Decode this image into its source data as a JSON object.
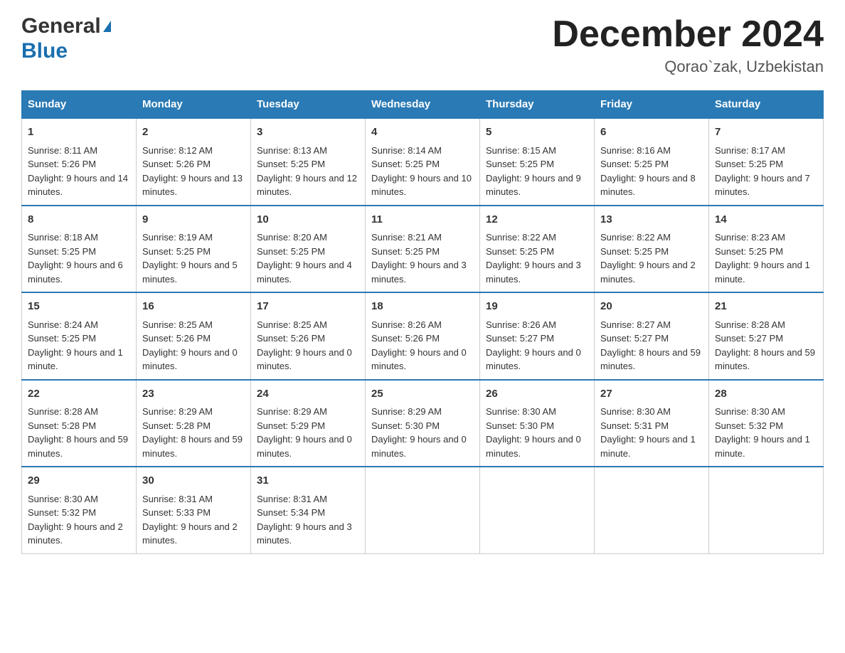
{
  "logo": {
    "line1": "General",
    "triangle": "▶",
    "line2": "Blue"
  },
  "title": "December 2024",
  "subtitle": "Qorao`zak, Uzbekistan",
  "days_of_week": [
    "Sunday",
    "Monday",
    "Tuesday",
    "Wednesday",
    "Thursday",
    "Friday",
    "Saturday"
  ],
  "weeks": [
    [
      {
        "day": "1",
        "sunrise": "Sunrise: 8:11 AM",
        "sunset": "Sunset: 5:26 PM",
        "daylight": "Daylight: 9 hours and 14 minutes."
      },
      {
        "day": "2",
        "sunrise": "Sunrise: 8:12 AM",
        "sunset": "Sunset: 5:26 PM",
        "daylight": "Daylight: 9 hours and 13 minutes."
      },
      {
        "day": "3",
        "sunrise": "Sunrise: 8:13 AM",
        "sunset": "Sunset: 5:25 PM",
        "daylight": "Daylight: 9 hours and 12 minutes."
      },
      {
        "day": "4",
        "sunrise": "Sunrise: 8:14 AM",
        "sunset": "Sunset: 5:25 PM",
        "daylight": "Daylight: 9 hours and 10 minutes."
      },
      {
        "day": "5",
        "sunrise": "Sunrise: 8:15 AM",
        "sunset": "Sunset: 5:25 PM",
        "daylight": "Daylight: 9 hours and 9 minutes."
      },
      {
        "day": "6",
        "sunrise": "Sunrise: 8:16 AM",
        "sunset": "Sunset: 5:25 PM",
        "daylight": "Daylight: 9 hours and 8 minutes."
      },
      {
        "day": "7",
        "sunrise": "Sunrise: 8:17 AM",
        "sunset": "Sunset: 5:25 PM",
        "daylight": "Daylight: 9 hours and 7 minutes."
      }
    ],
    [
      {
        "day": "8",
        "sunrise": "Sunrise: 8:18 AM",
        "sunset": "Sunset: 5:25 PM",
        "daylight": "Daylight: 9 hours and 6 minutes."
      },
      {
        "day": "9",
        "sunrise": "Sunrise: 8:19 AM",
        "sunset": "Sunset: 5:25 PM",
        "daylight": "Daylight: 9 hours and 5 minutes."
      },
      {
        "day": "10",
        "sunrise": "Sunrise: 8:20 AM",
        "sunset": "Sunset: 5:25 PM",
        "daylight": "Daylight: 9 hours and 4 minutes."
      },
      {
        "day": "11",
        "sunrise": "Sunrise: 8:21 AM",
        "sunset": "Sunset: 5:25 PM",
        "daylight": "Daylight: 9 hours and 3 minutes."
      },
      {
        "day": "12",
        "sunrise": "Sunrise: 8:22 AM",
        "sunset": "Sunset: 5:25 PM",
        "daylight": "Daylight: 9 hours and 3 minutes."
      },
      {
        "day": "13",
        "sunrise": "Sunrise: 8:22 AM",
        "sunset": "Sunset: 5:25 PM",
        "daylight": "Daylight: 9 hours and 2 minutes."
      },
      {
        "day": "14",
        "sunrise": "Sunrise: 8:23 AM",
        "sunset": "Sunset: 5:25 PM",
        "daylight": "Daylight: 9 hours and 1 minute."
      }
    ],
    [
      {
        "day": "15",
        "sunrise": "Sunrise: 8:24 AM",
        "sunset": "Sunset: 5:25 PM",
        "daylight": "Daylight: 9 hours and 1 minute."
      },
      {
        "day": "16",
        "sunrise": "Sunrise: 8:25 AM",
        "sunset": "Sunset: 5:26 PM",
        "daylight": "Daylight: 9 hours and 0 minutes."
      },
      {
        "day": "17",
        "sunrise": "Sunrise: 8:25 AM",
        "sunset": "Sunset: 5:26 PM",
        "daylight": "Daylight: 9 hours and 0 minutes."
      },
      {
        "day": "18",
        "sunrise": "Sunrise: 8:26 AM",
        "sunset": "Sunset: 5:26 PM",
        "daylight": "Daylight: 9 hours and 0 minutes."
      },
      {
        "day": "19",
        "sunrise": "Sunrise: 8:26 AM",
        "sunset": "Sunset: 5:27 PM",
        "daylight": "Daylight: 9 hours and 0 minutes."
      },
      {
        "day": "20",
        "sunrise": "Sunrise: 8:27 AM",
        "sunset": "Sunset: 5:27 PM",
        "daylight": "Daylight: 8 hours and 59 minutes."
      },
      {
        "day": "21",
        "sunrise": "Sunrise: 8:28 AM",
        "sunset": "Sunset: 5:27 PM",
        "daylight": "Daylight: 8 hours and 59 minutes."
      }
    ],
    [
      {
        "day": "22",
        "sunrise": "Sunrise: 8:28 AM",
        "sunset": "Sunset: 5:28 PM",
        "daylight": "Daylight: 8 hours and 59 minutes."
      },
      {
        "day": "23",
        "sunrise": "Sunrise: 8:29 AM",
        "sunset": "Sunset: 5:28 PM",
        "daylight": "Daylight: 8 hours and 59 minutes."
      },
      {
        "day": "24",
        "sunrise": "Sunrise: 8:29 AM",
        "sunset": "Sunset: 5:29 PM",
        "daylight": "Daylight: 9 hours and 0 minutes."
      },
      {
        "day": "25",
        "sunrise": "Sunrise: 8:29 AM",
        "sunset": "Sunset: 5:30 PM",
        "daylight": "Daylight: 9 hours and 0 minutes."
      },
      {
        "day": "26",
        "sunrise": "Sunrise: 8:30 AM",
        "sunset": "Sunset: 5:30 PM",
        "daylight": "Daylight: 9 hours and 0 minutes."
      },
      {
        "day": "27",
        "sunrise": "Sunrise: 8:30 AM",
        "sunset": "Sunset: 5:31 PM",
        "daylight": "Daylight: 9 hours and 1 minute."
      },
      {
        "day": "28",
        "sunrise": "Sunrise: 8:30 AM",
        "sunset": "Sunset: 5:32 PM",
        "daylight": "Daylight: 9 hours and 1 minute."
      }
    ],
    [
      {
        "day": "29",
        "sunrise": "Sunrise: 8:30 AM",
        "sunset": "Sunset: 5:32 PM",
        "daylight": "Daylight: 9 hours and 2 minutes."
      },
      {
        "day": "30",
        "sunrise": "Sunrise: 8:31 AM",
        "sunset": "Sunset: 5:33 PM",
        "daylight": "Daylight: 9 hours and 2 minutes."
      },
      {
        "day": "31",
        "sunrise": "Sunrise: 8:31 AM",
        "sunset": "Sunset: 5:34 PM",
        "daylight": "Daylight: 9 hours and 3 minutes."
      },
      null,
      null,
      null,
      null
    ]
  ]
}
